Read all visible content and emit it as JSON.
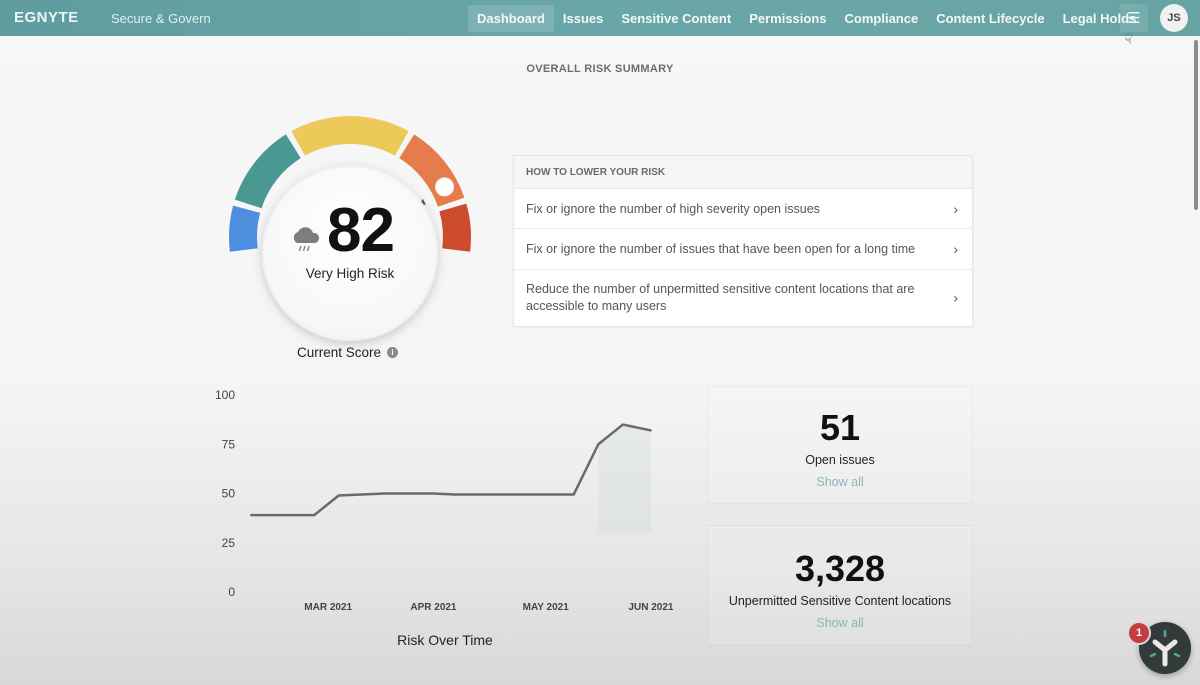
{
  "header": {
    "logo": "EGNYTE",
    "app_name": "Secure & Govern",
    "nav": [
      {
        "label": "Dashboard",
        "active": true
      },
      {
        "label": "Issues",
        "active": false
      },
      {
        "label": "Sensitive Content",
        "active": false
      },
      {
        "label": "Permissions",
        "active": false
      },
      {
        "label": "Compliance",
        "active": false
      },
      {
        "label": "Content Lifecycle",
        "active": false
      },
      {
        "label": "Legal Holds",
        "active": false
      }
    ],
    "menu_icon": "hamburger-icon",
    "avatar_initials": "JS"
  },
  "page": {
    "section_title": "OVERALL RISK SUMMARY"
  },
  "risk_score": {
    "value": "82",
    "level_label": "Very High Risk",
    "caption": "Current Score",
    "icon": "rain-cloud-icon",
    "gauge_segments": [
      {
        "name": "low",
        "color": "#4f8fe0"
      },
      {
        "name": "guarded",
        "color": "#4a9892"
      },
      {
        "name": "medium",
        "color": "#edc95a"
      },
      {
        "name": "high",
        "color": "#e47d4b"
      },
      {
        "name": "very-high",
        "color": "#cd4b2f"
      }
    ],
    "gauge_value_percent": 82
  },
  "tips": {
    "header": "HOW TO LOWER YOUR RISK",
    "items": [
      {
        "label": "Fix or ignore the number of high severity open issues"
      },
      {
        "label": "Fix or ignore the number of issues that have been open for a long time"
      },
      {
        "label": "Reduce the number of unpermitted sensitive content locations that are accessible to many users"
      }
    ]
  },
  "chart_data": {
    "type": "line",
    "title": "Risk Over Time",
    "xlabel": "",
    "ylabel": "",
    "ylim": [
      0,
      100
    ],
    "yticks": [
      0,
      25,
      50,
      75,
      100
    ],
    "xtick_labels": [
      "MAR 2021",
      "APR 2021",
      "MAY 2021",
      "JUN 2021"
    ],
    "xlim_days": [
      0,
      120
    ],
    "xtick_days": [
      22,
      52,
      84,
      114
    ],
    "grid": false,
    "series": [
      {
        "name": "Risk score",
        "color": "#6a6a6a",
        "points": [
          {
            "day": 0,
            "value": 39
          },
          {
            "day": 18,
            "value": 39
          },
          {
            "day": 25,
            "value": 49
          },
          {
            "day": 38,
            "value": 50
          },
          {
            "day": 52,
            "value": 50
          },
          {
            "day": 58,
            "value": 49.5
          },
          {
            "day": 92,
            "value": 49.5
          },
          {
            "day": 99,
            "value": 75
          },
          {
            "day": 106,
            "value": 85
          },
          {
            "day": 114,
            "value": 82
          }
        ]
      }
    ]
  },
  "stats": [
    {
      "value": "51",
      "label": "Open issues",
      "link": "Show all"
    },
    {
      "value": "3,328",
      "label": "Unpermitted Sensitive Content locations",
      "link": "Show all"
    }
  ],
  "helper": {
    "badge_count": "1",
    "icon": "egnyte-helper-icon"
  }
}
